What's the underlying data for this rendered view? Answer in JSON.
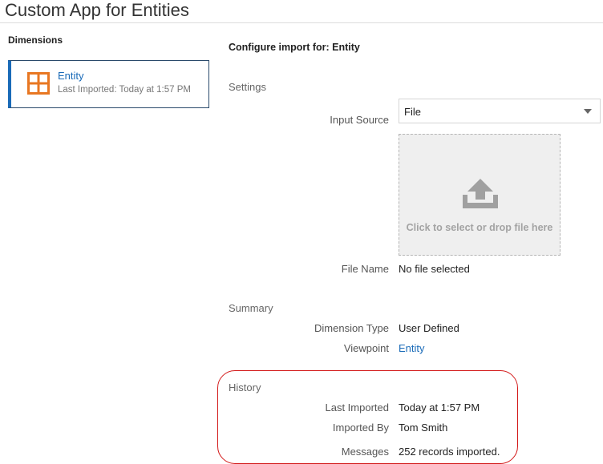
{
  "app": {
    "title": "Custom App for Entities"
  },
  "dimensions": {
    "heading": "Dimensions",
    "items": [
      {
        "name": "Entity",
        "last_imported": "Last Imported: Today at 1:57 PM",
        "icon": "grid-icon"
      }
    ]
  },
  "config": {
    "title": "Configure import for: Entity",
    "settings": {
      "label": "Settings",
      "input_source_label": "Input Source",
      "input_source_value": "File",
      "drop_text": "Click to select or drop file here",
      "file_name_label": "File Name",
      "file_name_value": "No file selected"
    },
    "summary": {
      "label": "Summary",
      "dimension_type_label": "Dimension Type",
      "dimension_type_value": "User Defined",
      "viewpoint_label": "Viewpoint",
      "viewpoint_value": "Entity"
    },
    "history": {
      "label": "History",
      "last_imported_label": "Last Imported",
      "last_imported_value": "Today at 1:57 PM",
      "imported_by_label": "Imported By",
      "imported_by_value": "Tom Smith",
      "messages_label": "Messages",
      "messages_value": "252 records imported."
    }
  },
  "colors": {
    "accent": "#1a6bb8",
    "icon_orange": "#e87722",
    "highlight_red": "#d31a1a"
  }
}
